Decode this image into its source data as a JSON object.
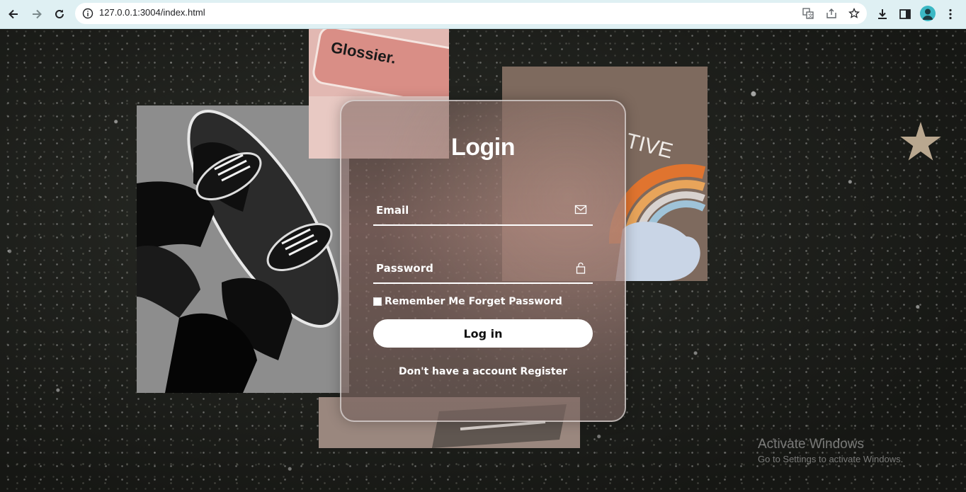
{
  "browser": {
    "url": "127.0.0.1:3004/index.html",
    "icons": [
      "back-arrow-icon",
      "forward-arrow-icon",
      "reload-icon",
      "info-icon",
      "translate-icon",
      "share-icon",
      "star-icon",
      "download-icon",
      "sidebar-icon",
      "avatar-icon",
      "more-vert-icon"
    ]
  },
  "login": {
    "title": "Login",
    "email_placeholder": "Email",
    "password_placeholder": "Password",
    "remember_label": "Remember Me",
    "forgot_label": "Forget Password",
    "login_button": "Log in",
    "no_account_text": "Don't have a account",
    "register_link": "Register"
  },
  "watermark": {
    "line1": "Activate Windows",
    "line2": "Go to Settings to activate Windows."
  },
  "colors": {
    "chrome_bg": "#dff0f3",
    "card_border": "#ffffff",
    "button_bg": "#ffffff",
    "avatar": "#3bb8c4"
  }
}
